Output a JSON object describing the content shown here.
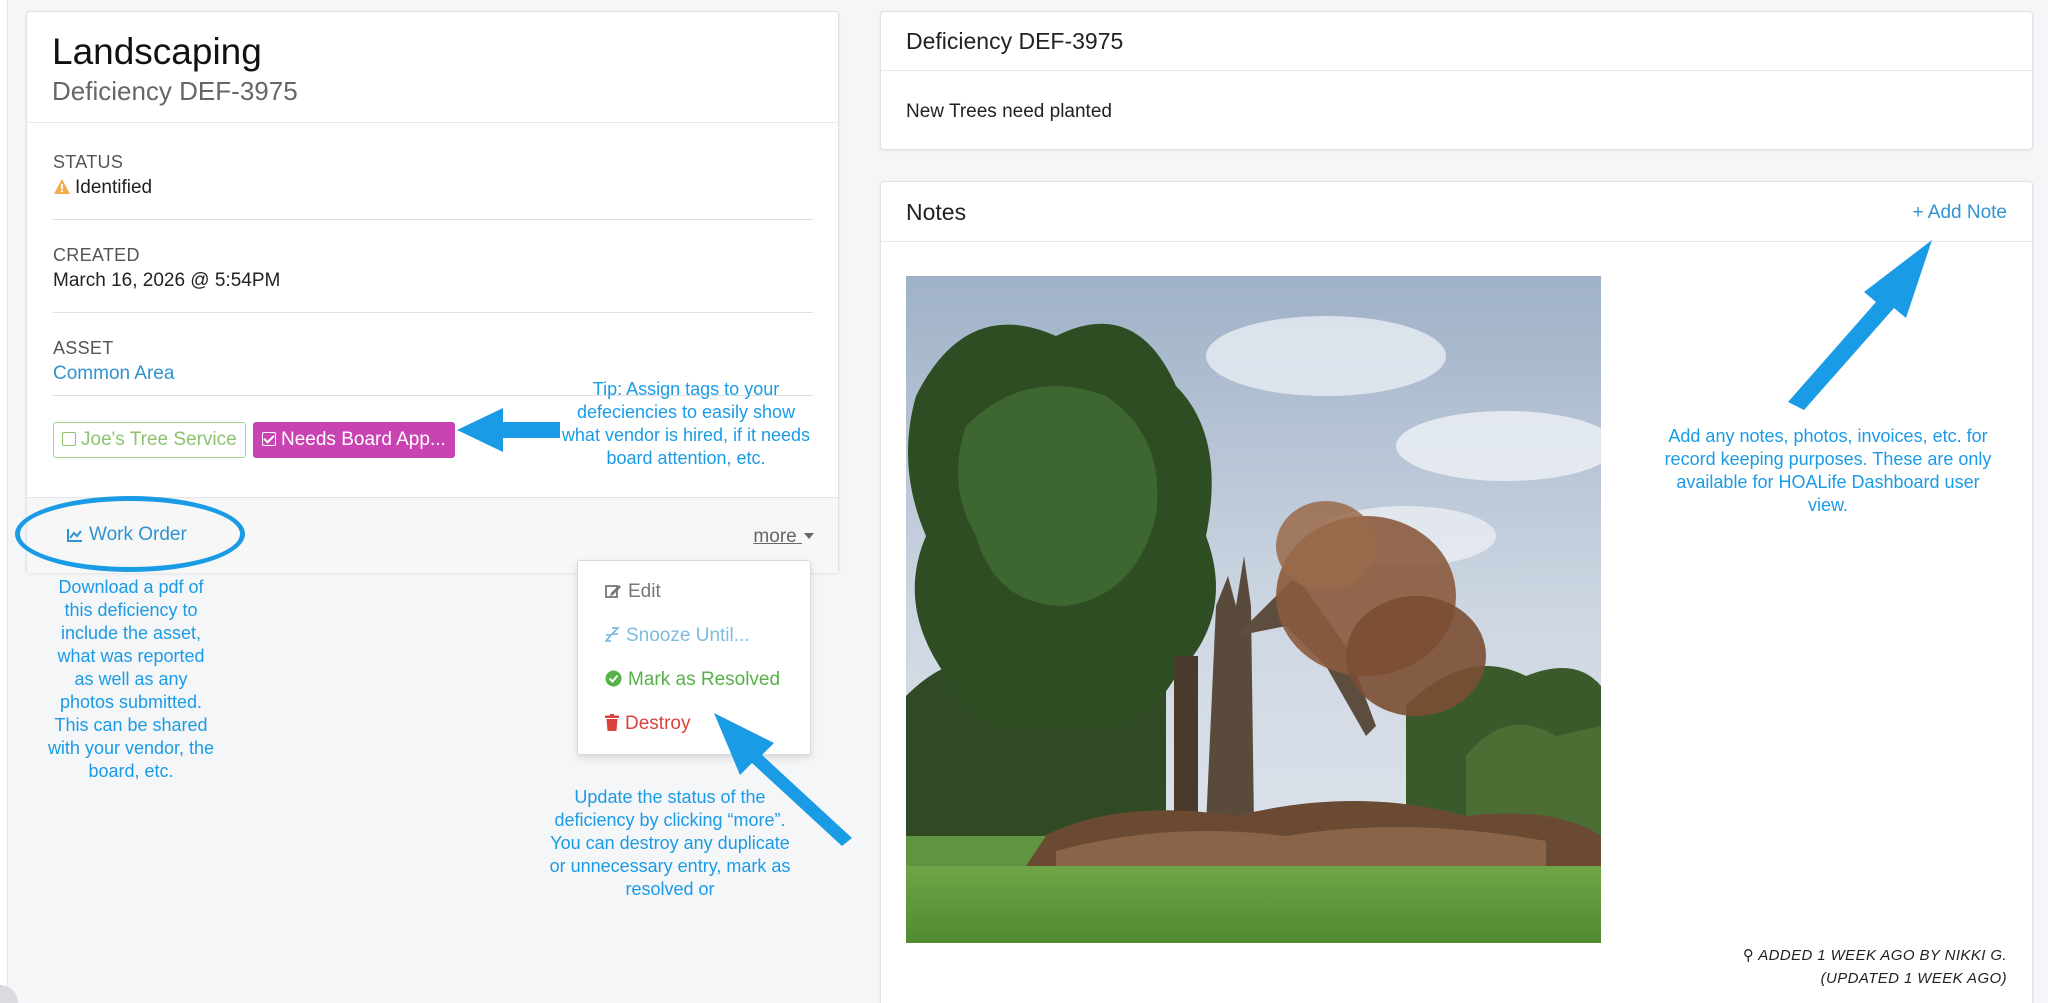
{
  "deficiency": {
    "category": "Landscaping",
    "id_label": "Deficiency DEF-3975",
    "status_label": "STATUS",
    "status_value": "Identified",
    "created_label": "CREATED",
    "created_value": "March 16, 2026 @ 5:54PM",
    "asset_label": "ASSET",
    "asset_value": "Common Area",
    "tags": [
      "Joe's Tree Service",
      "Needs Board App..."
    ],
    "work_order_label": "Work Order",
    "more_label": "more"
  },
  "more_menu": {
    "items": [
      "Edit",
      "Snooze Until...",
      "Mark as Resolved",
      "Destroy"
    ]
  },
  "description_card": {
    "title": "Deficiency DEF-3975",
    "body": "New Trees need planted"
  },
  "notes": {
    "title": "Notes",
    "add_label": "+ Add Note",
    "meta_line1": "ADDED 1 WEEK AGO BY NIKKI G.",
    "meta_line2": "(UPDATED 1 WEEK AGO)"
  },
  "annotations": {
    "tags_tip": "Tip: Assign tags to your defeciencies to easily show what vendor is hired, if it needs board attention, etc.",
    "work_order_tip": "Download a pdf of this deficiency to include the asset, what was reported as well as any photos submitted. This can be shared with your vendor, the board, etc.",
    "more_tip": "Update the status of the deficiency by clicking “more”. You can destroy any duplicate or unnecessary entry, mark as resolved or",
    "notes_tip": "Add any notes, photos, invoices, etc. for record keeping purposes. These are only available for HOALife Dashboard user view."
  },
  "colors": {
    "link": "#2f93d1",
    "annotation": "#1a9be6",
    "tag_vendor": "#8ec26f",
    "tag_board": "#c943b3",
    "warning": "#f0ad4e",
    "resolved": "#58b04a",
    "destroy": "#d9433e"
  },
  "icons": [
    "warning-icon",
    "checkbox-icon",
    "chart-icon",
    "edit-icon",
    "snooze-icon",
    "check-circle-icon",
    "trash-icon",
    "pin-icon"
  ]
}
